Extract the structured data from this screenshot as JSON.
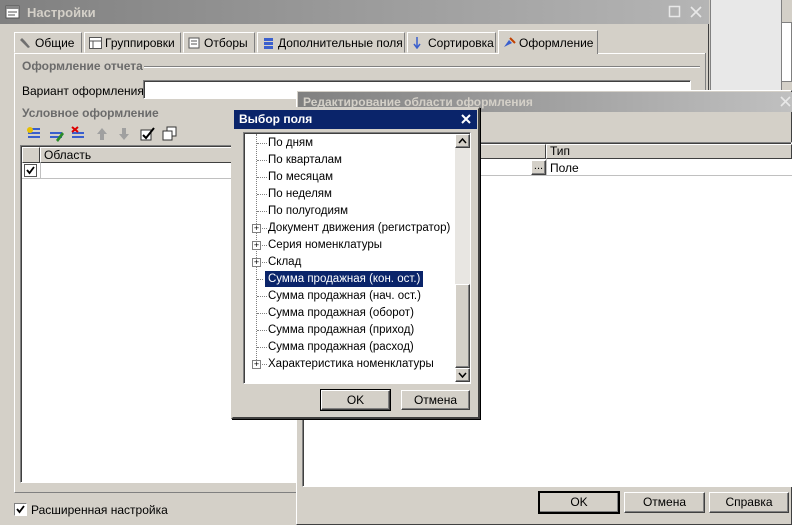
{
  "main_window": {
    "title": "Настройки",
    "tabs": [
      {
        "label": "Общие"
      },
      {
        "label": "Группировки"
      },
      {
        "label": "Отборы"
      },
      {
        "label": "Дополнительные поля"
      },
      {
        "label": "Сортировка"
      },
      {
        "label": "Оформление"
      }
    ],
    "section_report_design": "Оформление отчета",
    "variant_label": "Вариант оформления:",
    "variant_value": "",
    "section_conditional": "Условное оформление",
    "grid_header_area": "Область",
    "extended_settings_label": "Расширенная настройка"
  },
  "edit_window": {
    "title": "Редактирование области оформления",
    "grid_header_type": "Тип",
    "row_type": "Поле",
    "ellipsis": "...",
    "ok": "OK",
    "cancel": "Отмена",
    "help": "Справка"
  },
  "field_dialog": {
    "title": "Выбор поля",
    "close": "✕",
    "items": [
      {
        "label": "По дням",
        "expandable": false
      },
      {
        "label": "По кварталам",
        "expandable": false
      },
      {
        "label": "По месяцам",
        "expandable": false
      },
      {
        "label": "По неделям",
        "expandable": false
      },
      {
        "label": "По полугодиям",
        "expandable": false
      },
      {
        "label": "Документ движения (регистратор)",
        "expandable": true
      },
      {
        "label": "Серия номенклатуры",
        "expandable": true
      },
      {
        "label": "Склад",
        "expandable": true
      },
      {
        "label": "Сумма продажная (кон. ост.)",
        "expandable": false,
        "selected": true
      },
      {
        "label": "Сумма продажная (нач. ост.)",
        "expandable": false
      },
      {
        "label": "Сумма продажная (оборот)",
        "expandable": false
      },
      {
        "label": "Сумма продажная (приход)",
        "expandable": false
      },
      {
        "label": "Сумма продажная (расход)",
        "expandable": false
      },
      {
        "label": "Характеристика номенклатуры",
        "expandable": true
      }
    ],
    "ok": "OK",
    "cancel": "Отмена"
  },
  "colors": {
    "inactive_title": "#808080",
    "active_title": "#0a246a",
    "selection": "#0a246a",
    "window_face": "#d4d0c8"
  }
}
